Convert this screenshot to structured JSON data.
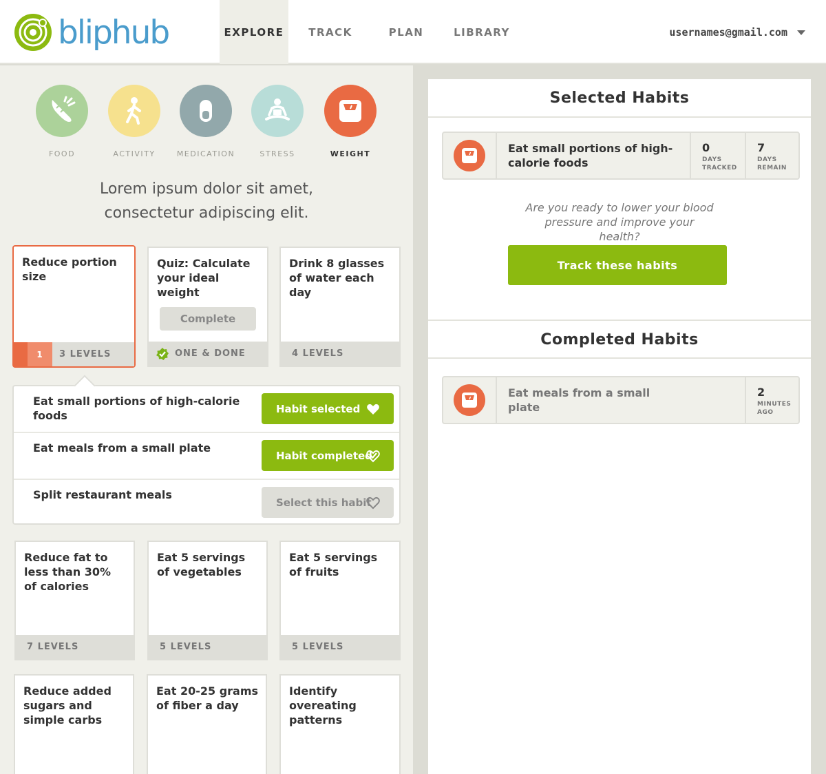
{
  "header": {
    "logo_text": "bliphub",
    "nav": [
      "EXPLORE",
      "TRACK",
      "PLAN",
      "LIBRARY"
    ],
    "user_email": "usernames@gmail.com"
  },
  "categories": [
    {
      "label": "FOOD",
      "icon": "carrot-icon",
      "color": "#acd29a"
    },
    {
      "label": "ACTIVITY",
      "icon": "walking-person-icon",
      "color": "#f6e18e"
    },
    {
      "label": "MEDICATION",
      "icon": "pill-icon",
      "color": "#92a8ab"
    },
    {
      "label": "STRESS",
      "icon": "meditation-icon",
      "color": "#b8ddd8"
    },
    {
      "label": "WEIGHT",
      "icon": "scale-icon",
      "color": "#e96a43"
    }
  ],
  "intro": {
    "line1": "Lorem ipsum dolor sit amet,",
    "line2": "consectetur adipiscing elit."
  },
  "cards": [
    {
      "title": "Reduce portion size",
      "level": "1",
      "footer": "3 LEVELS"
    },
    {
      "title": "Quiz: Calculate your ideal weight",
      "button": "Complete",
      "footer": "ONE & DONE"
    },
    {
      "title": "Drink 8 glasses of water each day",
      "footer": "4 LEVELS"
    },
    {
      "title": "Reduce fat to less than 30% of calories",
      "footer": "7 LEVELS"
    },
    {
      "title": "Eat 5 servings of vegetables",
      "footer": "5 LEVELS"
    },
    {
      "title": "Eat 5 servings of fruits",
      "footer": "5 LEVELS"
    },
    {
      "title": "Reduce added sugars and simple carbs"
    },
    {
      "title": "Eat 20-25 grams of fiber a day"
    },
    {
      "title": "Identify overeating patterns"
    }
  ],
  "habits": [
    {
      "text": "Eat small portions of high-calorie foods",
      "button": "Habit selected"
    },
    {
      "text": "Eat meals from a small plate",
      "button": "Habit completed"
    },
    {
      "text": "Split restaurant meals",
      "button": "Select this habit"
    }
  ],
  "selected": {
    "title": "Selected Habits",
    "habit": "Eat small portions of high-calorie foods",
    "days_tracked": "0",
    "days_tracked_label": "DAYS TRACKED",
    "days_remain": "7",
    "days_remain_label": "DAYS REMAIN",
    "prompt": "Are you ready to lower your blood pressure and improve your health?",
    "button": "Track these habits"
  },
  "completed": {
    "title": "Completed Habits",
    "habit": "Eat meals from a small plate",
    "ago": "2",
    "ago_label": "MINUTES AGO"
  },
  "colors": {
    "brand_blue": "#4a9ccc",
    "brand_green": "#8cba10",
    "accent_orange": "#e96a43"
  }
}
